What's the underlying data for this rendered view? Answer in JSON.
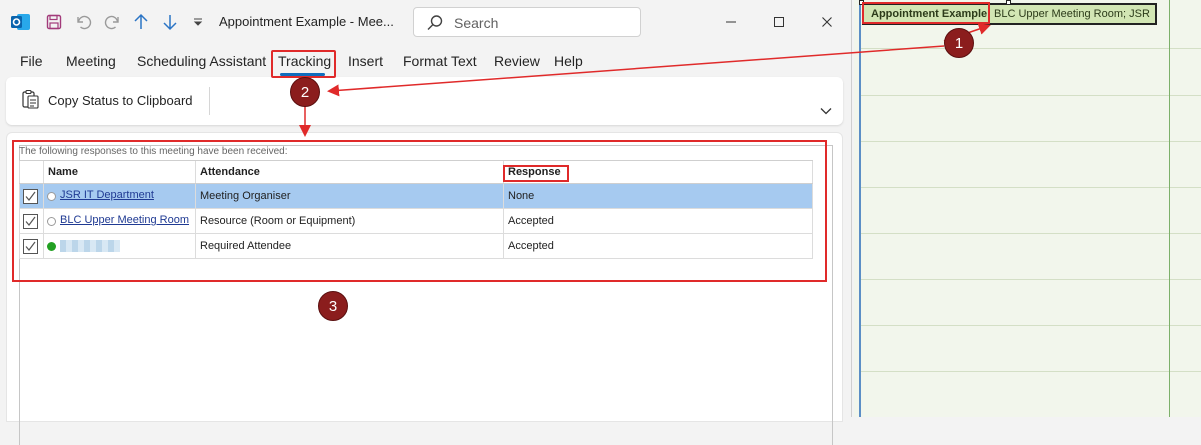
{
  "window": {
    "title": "Appointment Example  -  Mee...",
    "search_placeholder": "Search"
  },
  "ribbon_tabs": [
    {
      "label": "File"
    },
    {
      "label": "Meeting"
    },
    {
      "label": "Scheduling Assistant"
    },
    {
      "label": "Tracking",
      "active": true
    },
    {
      "label": "Insert"
    },
    {
      "label": "Format Text"
    },
    {
      "label": "Review"
    },
    {
      "label": "Help"
    }
  ],
  "ribbon": {
    "copy_status_label": "Copy Status to Clipboard"
  },
  "tracking": {
    "info_text": "The following responses to this meeting have been received:",
    "columns": [
      "Name",
      "Attendance",
      "Response"
    ],
    "rows": [
      {
        "name": "JSR IT Department",
        "attendance": "Meeting Organiser",
        "response": "None",
        "checked": true,
        "status": "none",
        "selected": true
      },
      {
        "name": "BLC Upper Meeting Room",
        "attendance": "Resource (Room or Equipment)",
        "response": "Accepted",
        "checked": true,
        "status": "none",
        "selected": false
      },
      {
        "name": "",
        "attendance": "Required Attendee",
        "response": "Accepted",
        "checked": true,
        "status": "accepted",
        "selected": false,
        "name_blurred": true
      }
    ]
  },
  "calendar": {
    "appointment_title": "Appointment Example",
    "appointment_location": "BLC Upper Meeting Room; JSR"
  },
  "annotations": {
    "badge_1": "1",
    "badge_2": "2",
    "badge_3": "3",
    "color": "#e02a2a"
  },
  "colors": {
    "accent": "#0f6cbd",
    "selected_row": "#a6caf0",
    "appointment_fill": "#d2e6b4",
    "badge_fill": "#8b1d1d"
  }
}
